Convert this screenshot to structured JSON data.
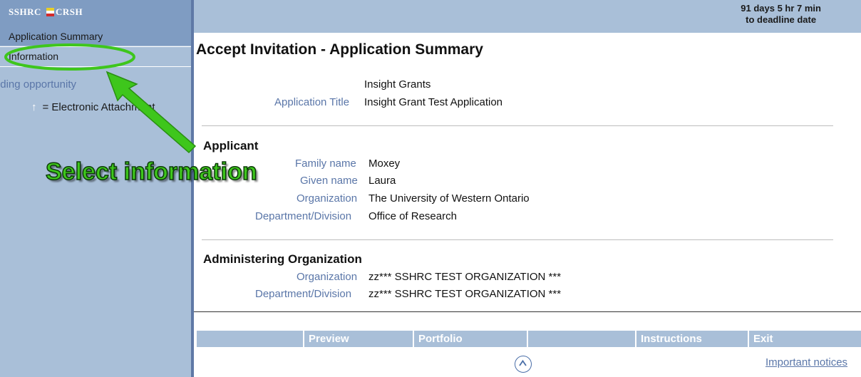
{
  "sidebar": {
    "logo_left": "SSHRC",
    "logo_right": "CRSH",
    "flag_colors": [
      "#e8cf2a",
      "#ffffff",
      "#d32a2a"
    ],
    "items": [
      {
        "label": "Application Summary",
        "selected": true
      },
      {
        "label": "Information",
        "selected": false
      }
    ],
    "legend_icon": "up-arrow-icon",
    "legend_arrow": "↑",
    "legend_text": "= Electronic Attachment"
  },
  "header": {
    "deadline_line1": "91 days 5 hr 7 min",
    "deadline_line2": "to deadline date"
  },
  "main": {
    "title": "Accept Invitation - Application Summary",
    "funding_opportunity_label": "Funding opportunity",
    "funding_opportunity_value": "Insight Grants",
    "application_title_label": "Application Title",
    "application_title_value": "Insight Grant Test Application",
    "applicant": {
      "heading": "Applicant",
      "family_name_label": "Family name",
      "family_name_value": "Moxey",
      "given_name_label": "Given name",
      "given_name_value": "Laura",
      "organization_label": "Organization",
      "organization_value": "The University of Western Ontario",
      "department_label": "Department/Division",
      "department_value": "Office of Research"
    },
    "administering": {
      "heading": "Administering Organization",
      "organization_label": "Organization",
      "organization_value": "zz*** SSHRC TEST ORGANIZATION ***",
      "department_label": "Department/Division",
      "department_value": "zz*** SSHRC TEST ORGANIZATION ***"
    }
  },
  "footer": {
    "buttons": [
      "Preview",
      "Portfolio",
      "Instructions",
      "Exit"
    ],
    "up_icon": "circle-up-arrow-icon",
    "notices_link": "Important notices"
  },
  "annotation": {
    "text": "Select information",
    "color": "#3ec61c"
  },
  "colors": {
    "panel_blue": "#a9bfd8",
    "selected_blue": "#7f9cc2",
    "label_blue": "#5a76a8"
  }
}
